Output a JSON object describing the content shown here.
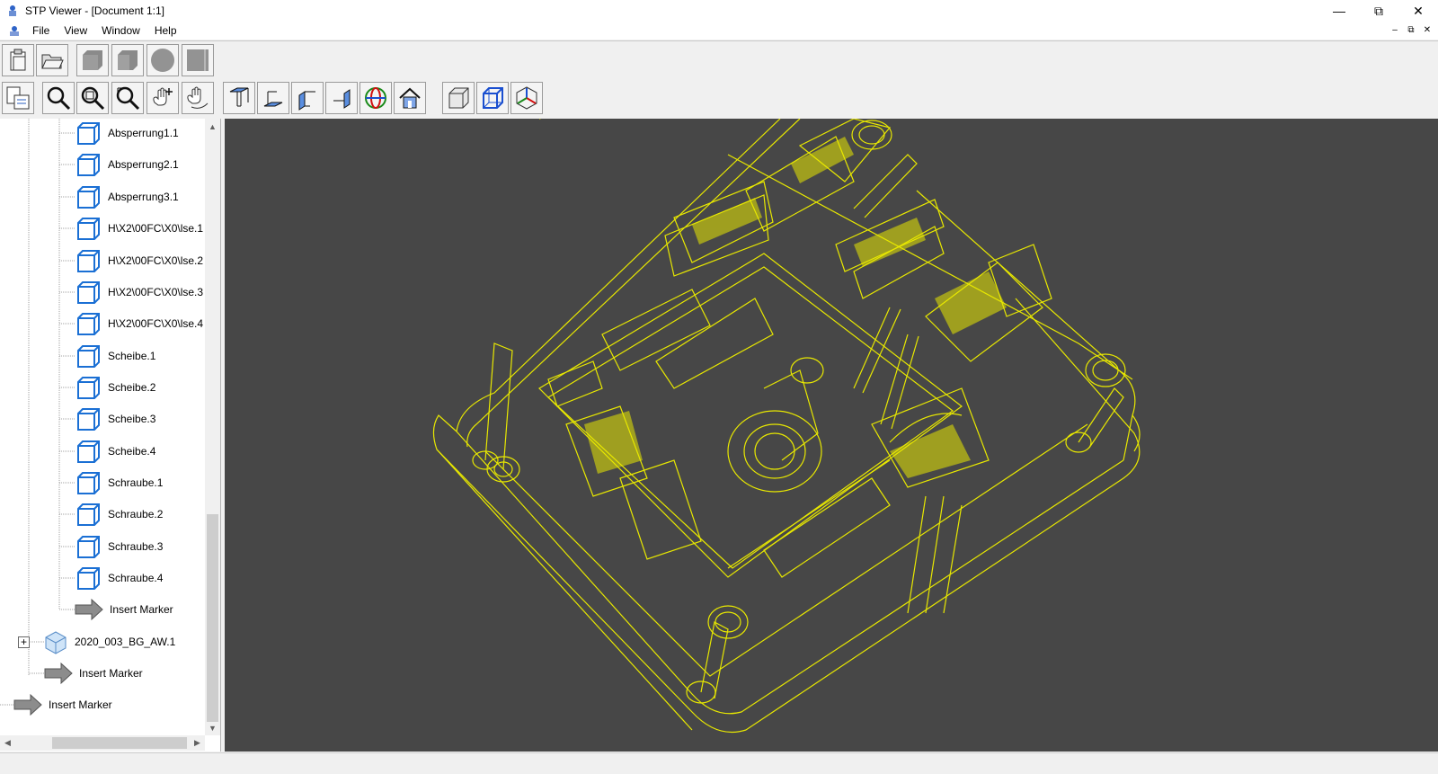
{
  "window": {
    "title": "STP Viewer - [Document 1:1]"
  },
  "menu": [
    "File",
    "View",
    "Window",
    "Help"
  ],
  "tree": {
    "children": [
      "Absperrung1.1",
      "Absperrung2.1",
      "Absperrung3.1",
      "H\\X2\\00FC\\X0\\lse.1",
      "H\\X2\\00FC\\X0\\lse.2",
      "H\\X2\\00FC\\X0\\lse.3",
      "H\\X2\\00FC\\X0\\lse.4",
      "Scheibe.1",
      "Scheibe.2",
      "Scheibe.3",
      "Scheibe.4",
      "Schraube.1",
      "Schraube.2",
      "Schraube.3",
      "Schraube.4"
    ],
    "insert_marker_1": "Insert Marker",
    "assembly": "2020_003_BG_AW.1",
    "insert_marker_2": "Insert Marker",
    "insert_marker_3": "Insert Marker"
  },
  "colors": {
    "viewport_bg": "#474747",
    "wireframe": "#e8e800",
    "part_icon": "#1a6fd4"
  }
}
